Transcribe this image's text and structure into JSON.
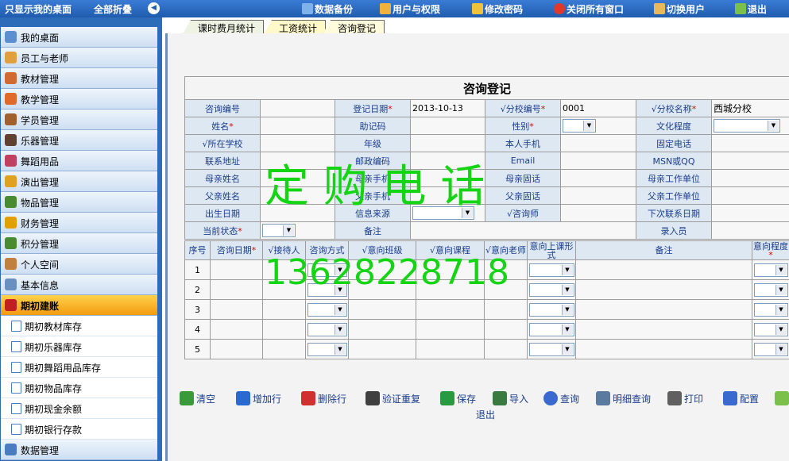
{
  "topbar": {
    "show_desktop": "只显示我的桌面",
    "collapse_all": "全部折叠",
    "collapse_icon": "chevron-left-icon",
    "actions": [
      {
        "label": "数据备份",
        "icon": "database-icon",
        "color": "#7fb2ea"
      },
      {
        "label": "用户与权限",
        "icon": "users-icon",
        "color": "#f0b23c"
      },
      {
        "label": "修改密码",
        "icon": "key-icon",
        "color": "#f0c23c"
      },
      {
        "label": "关闭所有窗口",
        "icon": "close-circle-icon",
        "color": "#e0392b"
      },
      {
        "label": "切换用户",
        "icon": "switch-user-icon",
        "color": "#e8b85c"
      },
      {
        "label": "退出",
        "icon": "exit-icon",
        "color": "#7cc04c"
      }
    ]
  },
  "sidebar": {
    "items": [
      {
        "label": "我的桌面",
        "icon": "desktop-icon",
        "color": "#5b8fd0"
      },
      {
        "label": "员工与老师",
        "icon": "people-icon",
        "color": "#e0a040"
      },
      {
        "label": "教材管理",
        "icon": "books-icon",
        "color": "#d06a30"
      },
      {
        "label": "教学管理",
        "icon": "calendar-icon",
        "color": "#e06a2a"
      },
      {
        "label": "学员管理",
        "icon": "student-icon",
        "color": "#a06030"
      },
      {
        "label": "乐器管理",
        "icon": "instrument-icon",
        "color": "#604030"
      },
      {
        "label": "舞蹈用品",
        "icon": "dance-icon",
        "color": "#c04060"
      },
      {
        "label": "演出管理",
        "icon": "performance-icon",
        "color": "#e0a020"
      },
      {
        "label": "物品管理",
        "icon": "items-icon",
        "color": "#4a8a30"
      },
      {
        "label": "财务管理",
        "icon": "money-icon",
        "color": "#e0a000"
      },
      {
        "label": "积分管理",
        "icon": "points-icon",
        "color": "#4a8a30"
      },
      {
        "label": "个人空间",
        "icon": "person-icon",
        "color": "#c08040"
      },
      {
        "label": "基本信息",
        "icon": "document-icon",
        "color": "#6a90c0"
      },
      {
        "label": "期初建账",
        "icon": "ledger-icon",
        "color": "#c02020"
      },
      {
        "label": "期初教材库存",
        "icon": "page-icon",
        "color": "#4a7dc0"
      },
      {
        "label": "期初乐器库存",
        "icon": "page-icon",
        "color": "#4a7dc0"
      },
      {
        "label": "期初舞蹈用品库存",
        "icon": "page-icon",
        "color": "#4a7dc0"
      },
      {
        "label": "期初物品库存",
        "icon": "page-icon",
        "color": "#4a7dc0"
      },
      {
        "label": "期初现金余额",
        "icon": "page-icon",
        "color": "#4a7dc0"
      },
      {
        "label": "期初银行存款",
        "icon": "page-icon",
        "color": "#4a7dc0"
      },
      {
        "label": "数据管理",
        "icon": "database-icon",
        "color": "#4a7dc0"
      }
    ]
  },
  "tabs": [
    "课时费月统计",
    "工资统计",
    "咨询登记"
  ],
  "form": {
    "title": "咨询登记",
    "consult_no": "咨询编号",
    "reg_date_label": "登记日期",
    "reg_date_value": "2013-10-13",
    "branch_no_label": "√分校编号",
    "branch_no_value": "0001",
    "branch_name_label": "√分校名称",
    "branch_name_value": "西城分校",
    "name_label": "姓名",
    "mnemonic_label": "助记码",
    "gender_label": "性别",
    "education_label": "文化程度",
    "school_label": "√所在学校",
    "grade_label": "年级",
    "mobile_label": "本人手机",
    "phone_label": "固定电话",
    "address_label": "联系地址",
    "postcode_label": "邮政编码",
    "email_label": "Email",
    "msn_label": "MSN或QQ",
    "mother_name_label": "母亲姓名",
    "mother_mobile_label": "母亲手机",
    "mother_phone_label": "母亲固话",
    "mother_work_label": "母亲工作单位",
    "father_name_label": "父亲姓名",
    "father_mobile_label": "父亲手机",
    "father_phone_label": "父亲固话",
    "father_work_label": "父亲工作单位",
    "birth_label": "出生日期",
    "source_label": "信息来源",
    "consultant_label": "√咨询师",
    "next_contact_label": "下次联系日期",
    "status_label": "当前状态",
    "remark_label": "备注",
    "entered_by_label": "录入员",
    "required_mark": "*"
  },
  "grid": {
    "headers": [
      "序号",
      "咨询日期",
      "√接待人",
      "咨询方式",
      "√意向班级",
      "√意向课程",
      "√意向老师",
      "意向上课形式",
      "备注",
      "意向程度"
    ],
    "rows": [
      "1",
      "2",
      "3",
      "4",
      "5"
    ]
  },
  "toolbar": {
    "buttons": [
      {
        "label": "清空",
        "icon": "clear-icon",
        "color": "#3a9a3a"
      },
      {
        "label": "增加行",
        "icon": "add-row-icon",
        "color": "#2a6ad0"
      },
      {
        "label": "删除行",
        "icon": "delete-row-icon",
        "color": "#d03030"
      },
      {
        "label": "验证重复",
        "icon": "verify-icon",
        "color": "#404040"
      },
      {
        "label": "保存",
        "icon": "save-icon",
        "color": "#2a9a40"
      },
      {
        "label": "导入",
        "icon": "import-icon",
        "color": "#3a7a40"
      },
      {
        "label": "查询",
        "icon": "search-icon",
        "color": "#3a6ad0"
      },
      {
        "label": "明细查询",
        "icon": "detail-search-icon",
        "color": "#5a7aa0"
      },
      {
        "label": "打印",
        "icon": "print-icon",
        "color": "#606060"
      },
      {
        "label": "配置",
        "icon": "config-icon",
        "color": "#3a6ad0"
      }
    ],
    "exit_label": "退出"
  },
  "watermark": {
    "text": "定 购 电 话",
    "phone": "13628228718",
    "color": "#14d414"
  }
}
